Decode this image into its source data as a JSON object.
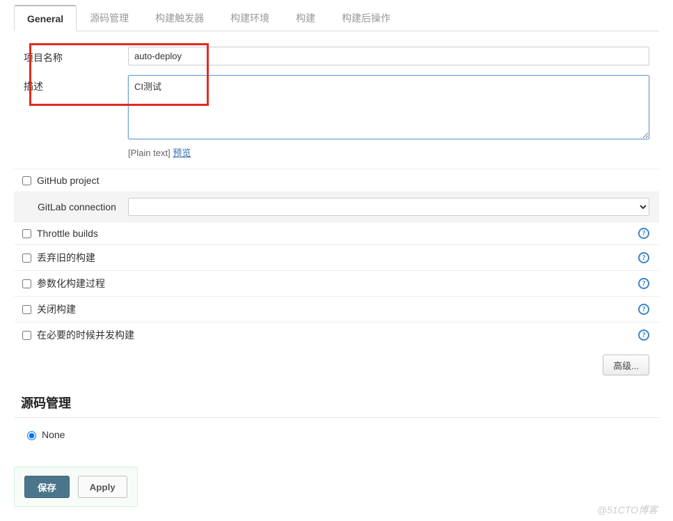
{
  "tabs": [
    {
      "id": "general",
      "label": "General",
      "active": true
    },
    {
      "id": "scm",
      "label": "源码管理",
      "active": false
    },
    {
      "id": "triggers",
      "label": "构建触发器",
      "active": false
    },
    {
      "id": "env",
      "label": "构建环境",
      "active": false
    },
    {
      "id": "build",
      "label": "构建",
      "active": false
    },
    {
      "id": "post",
      "label": "构建后操作",
      "active": false
    }
  ],
  "form": {
    "project_name_label": "项目名称",
    "project_name_value": "auto-deploy",
    "description_label": "描述",
    "description_value": "CI测试",
    "plain_text_tag": "[Plain text]",
    "preview_link": "预览"
  },
  "options": {
    "github_project": "GitHub project",
    "gitlab_connection": "GitLab connection",
    "throttle_builds": "Throttle builds",
    "discard_old_builds": "丢弃旧的构建",
    "parameterized_build": "参数化构建过程",
    "disable_build": "关闭构建",
    "concurrent_if_needed": "在必要的时候并发构建"
  },
  "advanced_button": "高级...",
  "scm_section_title": "源码管理",
  "scm_none_label": "None",
  "footer": {
    "save": "保存",
    "apply": "Apply"
  },
  "watermark": "@51CTO博客"
}
